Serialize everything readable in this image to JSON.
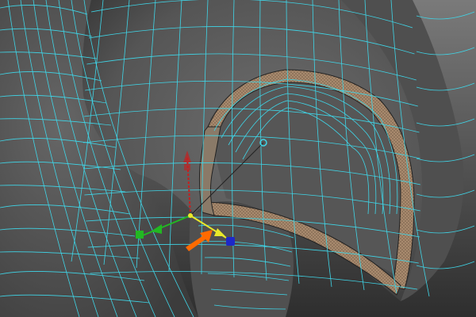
{
  "viewport": {
    "view": "perspective",
    "background_top": "#7a7a7a",
    "background_bottom": "#2e2e2e",
    "mesh_fill": "#5c5c5c",
    "mesh_shadow": "#3b3b3b",
    "wire_color": "#3fd6e8",
    "selected_face_color": "#a88a6e",
    "selected_face_pattern": "#6b5440"
  },
  "manipulator": {
    "type": "move-tool",
    "x_axis_color": "#c81e1e",
    "y_axis_color": "#e8e82a",
    "z_axis_color": "#1e28c8",
    "green_axis_color": "#22b822",
    "pivot_color": "#3fd6e8"
  },
  "annotation": {
    "arrow_color": "#ff6a00",
    "icon": "orange-arrow-icon"
  }
}
